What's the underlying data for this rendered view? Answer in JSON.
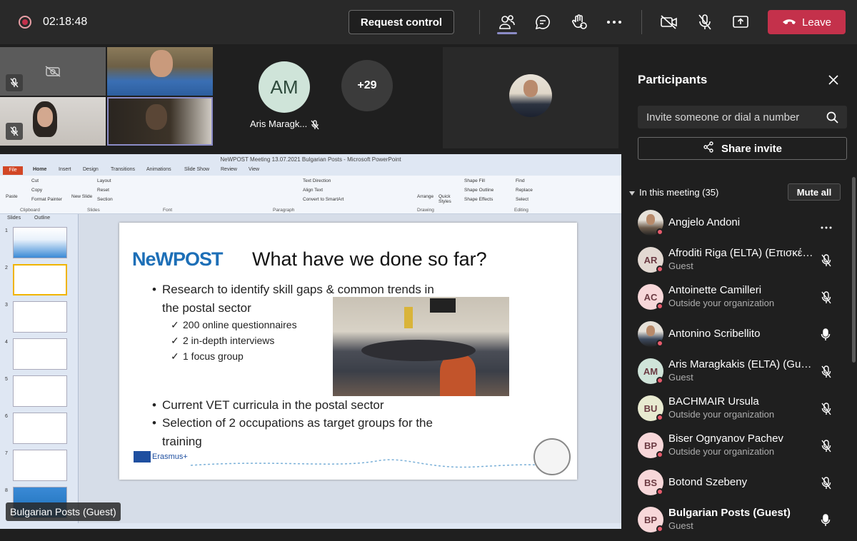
{
  "topbar": {
    "timer": "02:18:48",
    "request_control": "Request control",
    "leave": "Leave",
    "icons": [
      "participants-icon",
      "chat-icon",
      "raise-hand-icon",
      "more-icon",
      "camera-off-icon",
      "mic-off-icon",
      "share-screen-icon",
      "phone-hangup-icon"
    ]
  },
  "gallery": {
    "avatar_initials": "AM",
    "avatar_name": "Aris Maragk...",
    "overflow_count": "+29"
  },
  "presentation": {
    "window_title": "NeWPOST Meeting 13.07.2021 Bulgarian Posts  -  Microsoft PowerPoint",
    "tabs": [
      "File",
      "Home",
      "Insert",
      "Design",
      "Transitions",
      "Animations",
      "Slide Show",
      "Review",
      "View"
    ],
    "ribbon_groups": [
      "Clipboard",
      "Slides",
      "Font",
      "Paragraph",
      "Drawing",
      "Editing"
    ],
    "ribbon_items": {
      "paste": "Paste",
      "cut": "Cut",
      "copy": "Copy",
      "format_painter": "Format Painter",
      "new_slide": "New Slide",
      "layout": "Layout",
      "reset": "Reset",
      "section": "Section",
      "text_direction": "Text Direction",
      "align_text": "Align Text",
      "convert_smartart": "Convert to SmartArt",
      "arrange": "Arrange",
      "quick_styles": "Quick Styles",
      "shape_fill": "Shape Fill",
      "shape_outline": "Shape Outline",
      "shape_effects": "Shape Effects",
      "find": "Find",
      "replace": "Replace",
      "select": "Select"
    },
    "pane_tabs": [
      "Slides",
      "Outline"
    ],
    "slide_numbers": [
      "1",
      "2",
      "3",
      "4",
      "5",
      "6",
      "7",
      "8"
    ],
    "slide": {
      "logo": "NeWPOST",
      "title": "What have we done so far?",
      "bullet1_line1": "Research to identify skill gaps & common trends in",
      "bullet1_line2": "the postal sector",
      "sub1": "200 online questionnaires",
      "sub2": "2 in-depth interviews",
      "sub3": "1 focus group",
      "bullet2": "Current VET curricula in the postal sector",
      "bullet3_line1": "Selection of 2 occupations as target groups for the",
      "bullet3_line2": "training",
      "erasmus": "Erasmus+"
    },
    "presenter_name": "Bulgarian Posts (Guest)"
  },
  "panel": {
    "title": "Participants",
    "invite_placeholder": "Invite someone or dial a number",
    "share_invite": "Share invite",
    "section": "In this meeting (35)",
    "mute_all": "Mute all",
    "participants": [
      {
        "initials": "",
        "name": "Angjelo Andoni",
        "sub": "",
        "mic": "more",
        "photo": true,
        "color": "#6b5a4a"
      },
      {
        "initials": "AR",
        "name": "Afroditi Riga (ELTA) (Επισκέπτ...",
        "sub": "Guest",
        "mic": "off",
        "photo": false,
        "color": "#e3d9d2"
      },
      {
        "initials": "AC",
        "name": "Antoinette Camilleri",
        "sub": "Outside your organization",
        "mic": "off",
        "photo": false,
        "color": "#f7d7d9"
      },
      {
        "initials": "",
        "name": "Antonino Scribellito",
        "sub": "",
        "mic": "on",
        "photo": true,
        "color": "#3d4a5e"
      },
      {
        "initials": "AM",
        "name": "Aris Maragkakis (ELTA) (Guest)",
        "sub": "Guest",
        "mic": "off",
        "photo": false,
        "color": "#cfe4d9"
      },
      {
        "initials": "BU",
        "name": "BACHMAIR Ursula",
        "sub": "Outside your organization",
        "mic": "off",
        "photo": false,
        "color": "#e8ead0"
      },
      {
        "initials": "BP",
        "name": "Biser Ognyanov Pachev",
        "sub": "Outside your organization",
        "mic": "off",
        "photo": false,
        "color": "#f7d7d9"
      },
      {
        "initials": "BS",
        "name": "Botond Szebeny",
        "sub": "",
        "mic": "off",
        "photo": false,
        "color": "#f7d7d9"
      },
      {
        "initials": "BP",
        "name": "Bulgarian Posts (Guest)",
        "sub": "Guest",
        "mic": "on",
        "photo": false,
        "color": "#f7d7d9"
      }
    ]
  },
  "colors": {
    "leave": "#c4314b",
    "accent": "#8b8cc7",
    "panel_bg": "#1f1f1f",
    "topbar_bg": "#292929"
  }
}
